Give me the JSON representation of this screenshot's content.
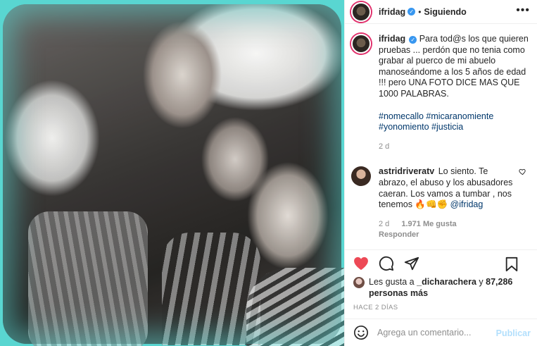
{
  "post": {
    "author": "ifridag",
    "follow_status": "Siguiendo",
    "separator": "•",
    "more_menu": "•••",
    "caption_author": "ifridag",
    "caption": "Para tod@s los que quieren pruebas ... perdón que no tenia como grabar al puerco de mi abuelo manoseándome a los 5 años de edad !!! pero UNA FOTO DICE MAS QUE 1000 PALABRAS.",
    "hashtags": "#nomecallo #micaranomiente #yonomiento #justicia",
    "caption_time": "2 d"
  },
  "comment": {
    "author": "astridriveratv",
    "text_before": "Lo siento. Te abrazo, el abuso y los abusadores caeran. Los vamos a tumbar , nos tenemos 🔥👊✊",
    "mention": "@ifridag",
    "time": "2 d",
    "likes": "1.971 Me gusta",
    "reply": "Responder"
  },
  "likes": {
    "prefix": "Les gusta a",
    "user": "_dicharachera",
    "conj": "y",
    "count": "87,286 personas más"
  },
  "date_label": "HACE 2 DÍAS",
  "composer": {
    "placeholder": "Agrega un comentario...",
    "publish": "Publicar"
  },
  "colors": {
    "photo_border": "#59d6d1",
    "verified": "#3897f0",
    "link": "#00376b",
    "like_red": "#ed4956",
    "publish_disabled": "#b2dffc"
  }
}
